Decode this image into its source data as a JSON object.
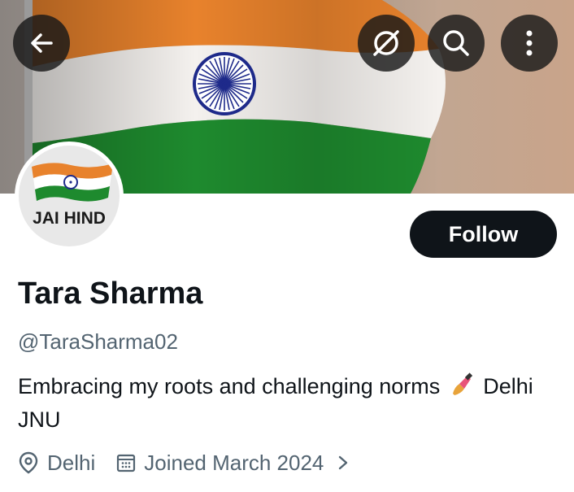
{
  "banner": {
    "description_icon": "indian-flag"
  },
  "toolbar": {
    "back_icon": "back-arrow-icon",
    "grok_icon": "grok-icon",
    "search_icon": "search-icon",
    "more_icon": "more-vertical-icon"
  },
  "avatar": {
    "text": "JAI HIND"
  },
  "follow_label": "Follow",
  "profile": {
    "name": "Tara Sharma",
    "handle": "@TaraSharma02",
    "bio_part1": "Embracing my roots and challenging norms",
    "bio_emoji": "nail-polish-emoji",
    "bio_part2": "Delhi JNU",
    "location": "Delhi",
    "joined": "Joined March 2024"
  },
  "colors": {
    "saffron": "#E8822C",
    "green": "#1E8A2E",
    "chakra": "#1E2A8A",
    "text_primary": "#0f1419",
    "text_secondary": "#536471"
  }
}
